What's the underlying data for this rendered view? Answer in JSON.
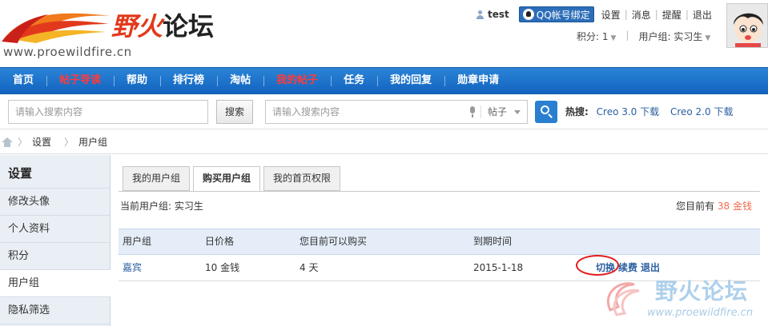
{
  "header": {
    "logo_char1": "野火",
    "logo_char2": "论坛",
    "logo_url": "www.proewildfire.cn",
    "user": {
      "name": "test",
      "qq_bind_label": "QQ帐号绑定",
      "links": [
        "设置",
        "消息",
        "提醒",
        "退出"
      ]
    },
    "points_label": "积分: 1",
    "usergroup_label": "用户组: 实习生"
  },
  "nav": {
    "items": [
      {
        "label": "首页",
        "highlight": false
      },
      {
        "label": "帖子导读",
        "highlight": true
      },
      {
        "label": "帮助",
        "highlight": false
      },
      {
        "label": "排行榜",
        "highlight": false
      },
      {
        "label": "淘帖",
        "highlight": false
      },
      {
        "label": "我的帖子",
        "highlight": true
      },
      {
        "label": "任务",
        "highlight": false
      },
      {
        "label": "我的回复",
        "highlight": false
      },
      {
        "label": "勋章申请",
        "highlight": false
      }
    ]
  },
  "search": {
    "placeholder1": "请输入搜索内容",
    "button_label": "搜索",
    "placeholder2": "请输入搜索内容",
    "type_label": "帖子",
    "hot_label": "热搜:",
    "hot_keywords": [
      "Creo 3.0 下载",
      "Creo 2.0 下载"
    ]
  },
  "breadcrumb": {
    "items": [
      "设置",
      "用户组"
    ]
  },
  "sidebar": {
    "title": "设置",
    "items": [
      {
        "label": "修改头像",
        "active": false
      },
      {
        "label": "个人资料",
        "active": false
      },
      {
        "label": "积分",
        "active": false
      },
      {
        "label": "用户组",
        "active": true
      },
      {
        "label": "隐私筛选",
        "active": false
      }
    ]
  },
  "tabs": [
    {
      "label": "我的用户组",
      "active": false
    },
    {
      "label": "购买用户组",
      "active": true
    },
    {
      "label": "我的首页权限",
      "active": false
    }
  ],
  "current_group": {
    "label": "当前用户组: 实习生",
    "balance_prefix": "您目前有",
    "balance_value": "38 金钱"
  },
  "table": {
    "headers": [
      "用户组",
      "日价格",
      "您目前可以购买",
      "到期时间",
      ""
    ],
    "rows": [
      {
        "group": "嘉宾",
        "price": "10 金钱",
        "can_buy": "4 天",
        "expire": "2015-1-18",
        "actions": [
          "切换",
          "续费",
          "退出"
        ]
      }
    ]
  },
  "watermark": {
    "title": "野火论坛",
    "url": "www.proewildfire.cn"
  },
  "colors": {
    "nav_bg": "#1a6fc9",
    "nav_highlight": "#ff3b3b",
    "link": "#2a5fa0",
    "accent_number": "#f26c4f",
    "circle_mark": "#e01b1b"
  }
}
